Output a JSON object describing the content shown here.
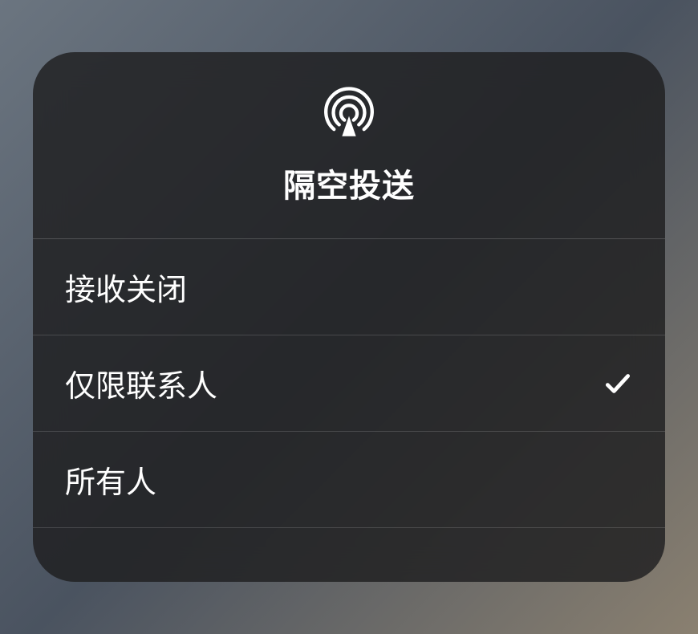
{
  "popup": {
    "title": "隔空投送",
    "options": [
      {
        "label": "接收关闭",
        "selected": false
      },
      {
        "label": "仅限联系人",
        "selected": true
      },
      {
        "label": "所有人",
        "selected": false
      }
    ]
  }
}
